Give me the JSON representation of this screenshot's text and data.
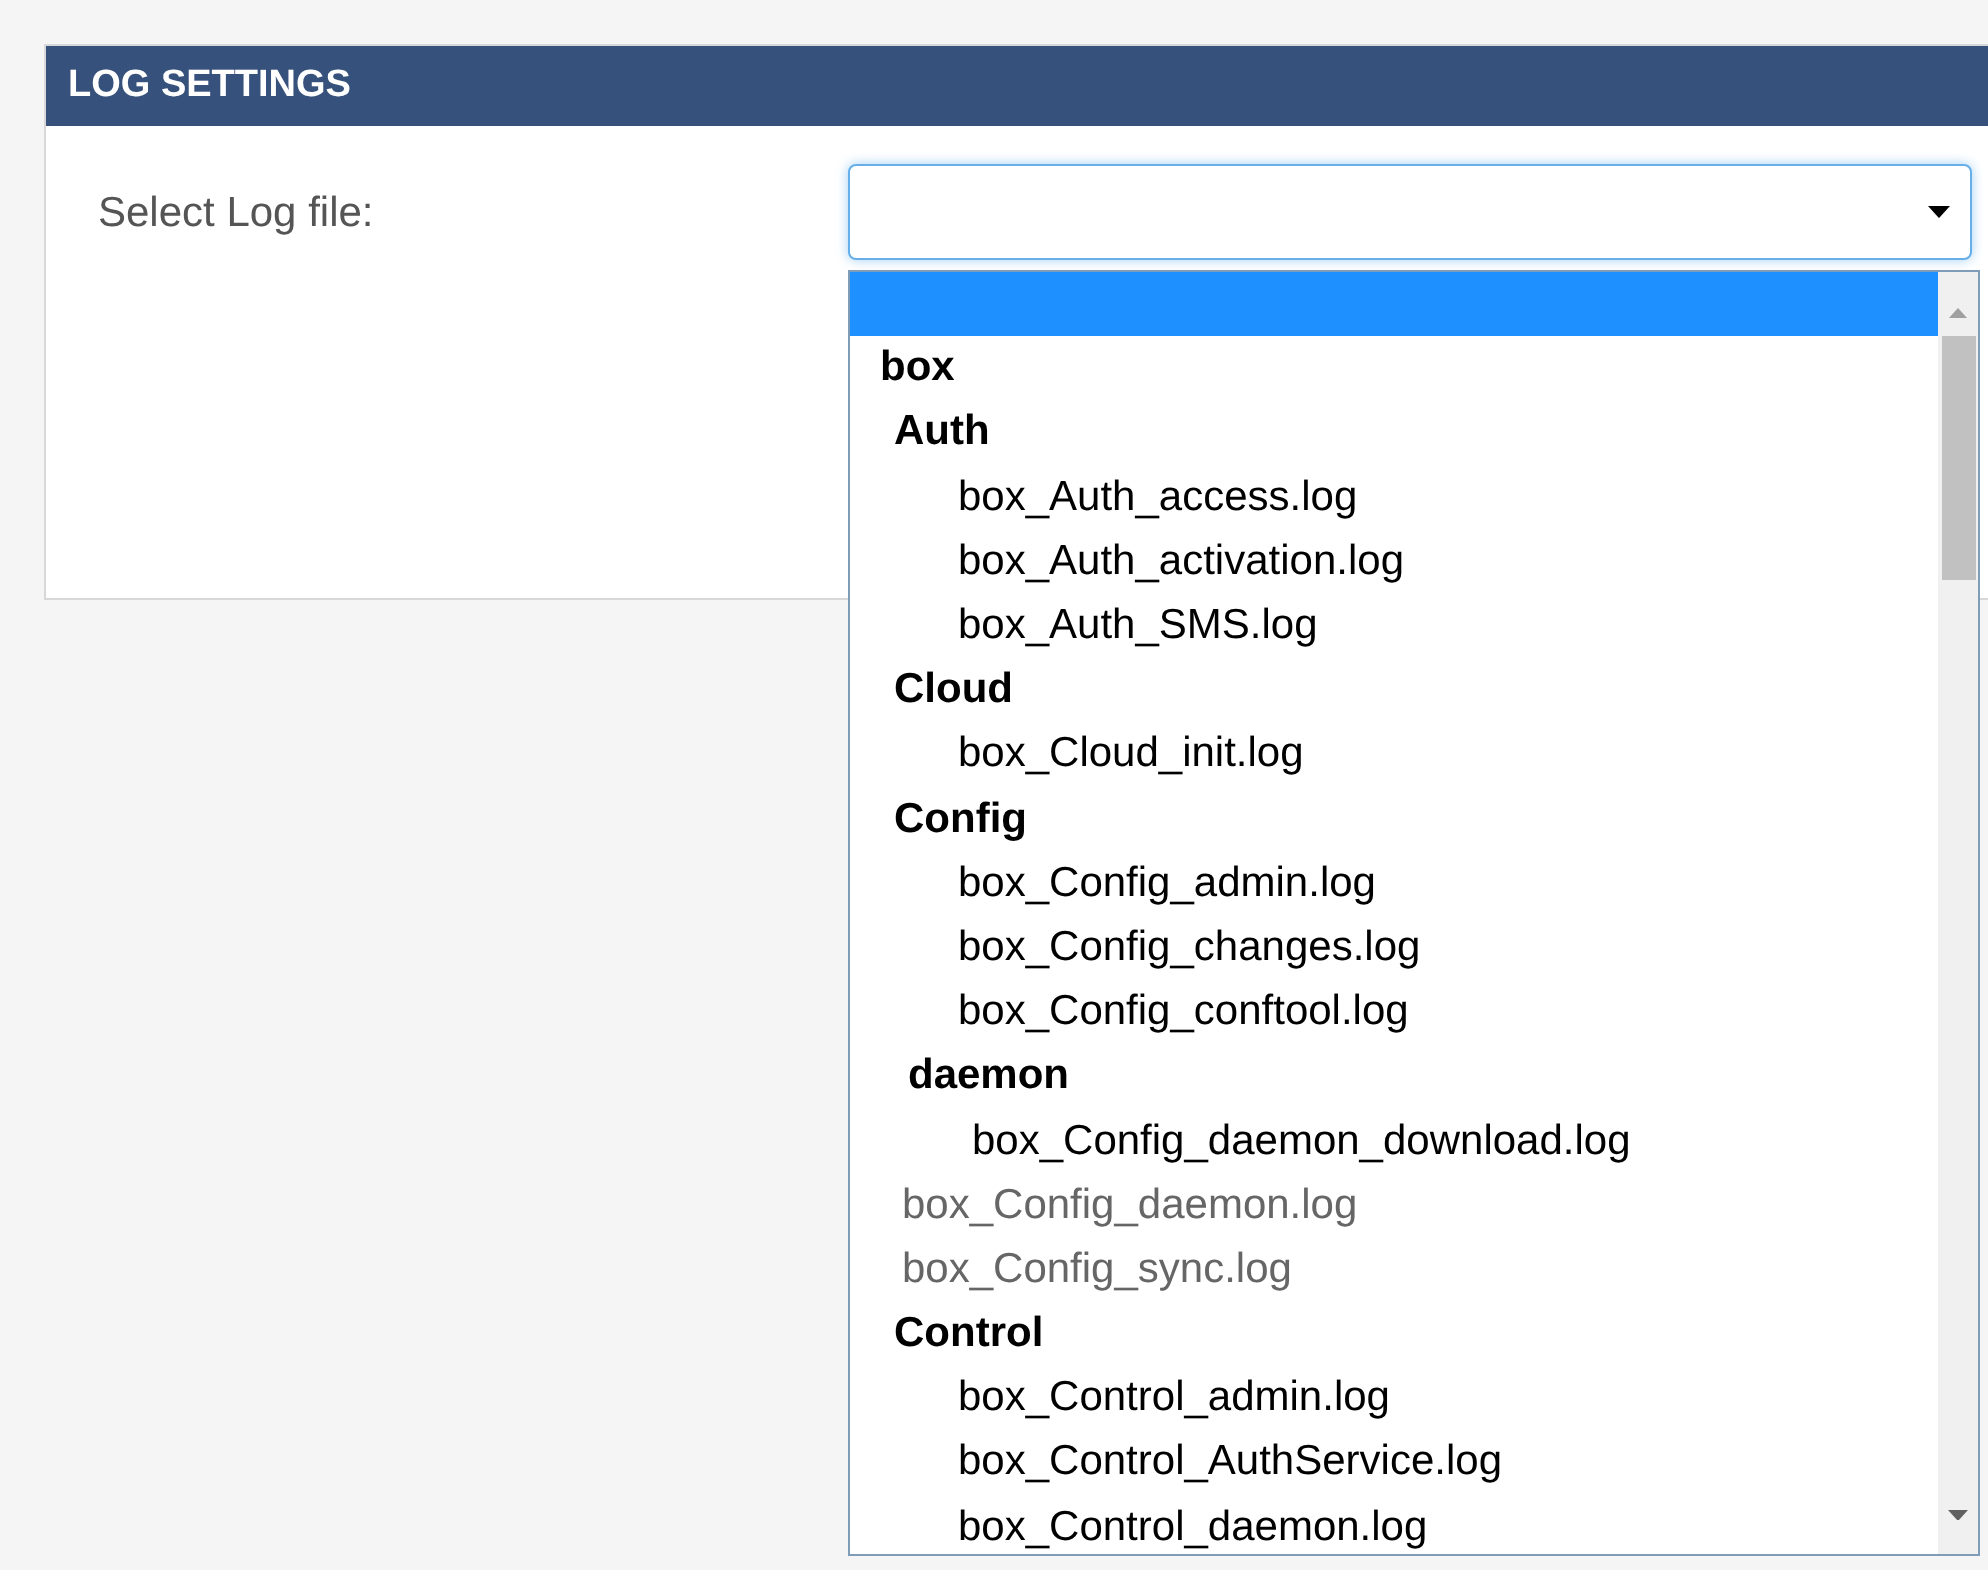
{
  "panel": {
    "title": "LOG SETTINGS"
  },
  "field": {
    "label": "Select Log file:"
  },
  "options": [
    {
      "kind": "option",
      "selected": true
    },
    {
      "kind": "group",
      "label": "box",
      "children": [
        {
          "kind": "group",
          "label": "Auth",
          "children": [
            {
              "kind": "option",
              "label": "box_Auth_access.log",
              "selected": false
            },
            {
              "kind": "option",
              "label": "box_Auth_activation.log",
              "selected": false
            },
            {
              "kind": "option",
              "label": "box_Auth_SMS.log",
              "selected": false
            }
          ]
        },
        {
          "kind": "group",
          "label": "Cloud",
          "children": [
            {
              "kind": "option",
              "label": "box_Cloud_init.log",
              "selected": false
            }
          ]
        },
        {
          "kind": "group",
          "label": "Config",
          "children": [
            {
              "kind": "option",
              "label": "box_Config_admin.log",
              "selected": false
            },
            {
              "kind": "option",
              "label": "box_Config_changes.log",
              "selected": false
            },
            {
              "kind": "option",
              "label": "box_Config_conftool.log",
              "selected": false
            },
            {
              "kind": "group",
              "label": "daemon",
              "children": [
                {
                  "kind": "option",
                  "label": "box_Config_daemon_download.log",
                  "selected": false
                }
              ]
            },
            {
              "kind": "option",
              "label": "box_Config_daemon.log",
              "selected": false,
              "disabled": true
            },
            {
              "kind": "option",
              "label": "box_Config_sync.log",
              "selected": false,
              "disabled": true
            }
          ]
        },
        {
          "kind": "group",
          "label": "Control",
          "children": [
            {
              "kind": "option",
              "label": "box_Control_admin.log",
              "selected": false
            },
            {
              "kind": "option",
              "label": "box_Control_AuthService.log",
              "selected": false
            },
            {
              "kind": "option",
              "label": "box_Control_daemon.log",
              "selected": false
            }
          ]
        }
      ]
    }
  ]
}
